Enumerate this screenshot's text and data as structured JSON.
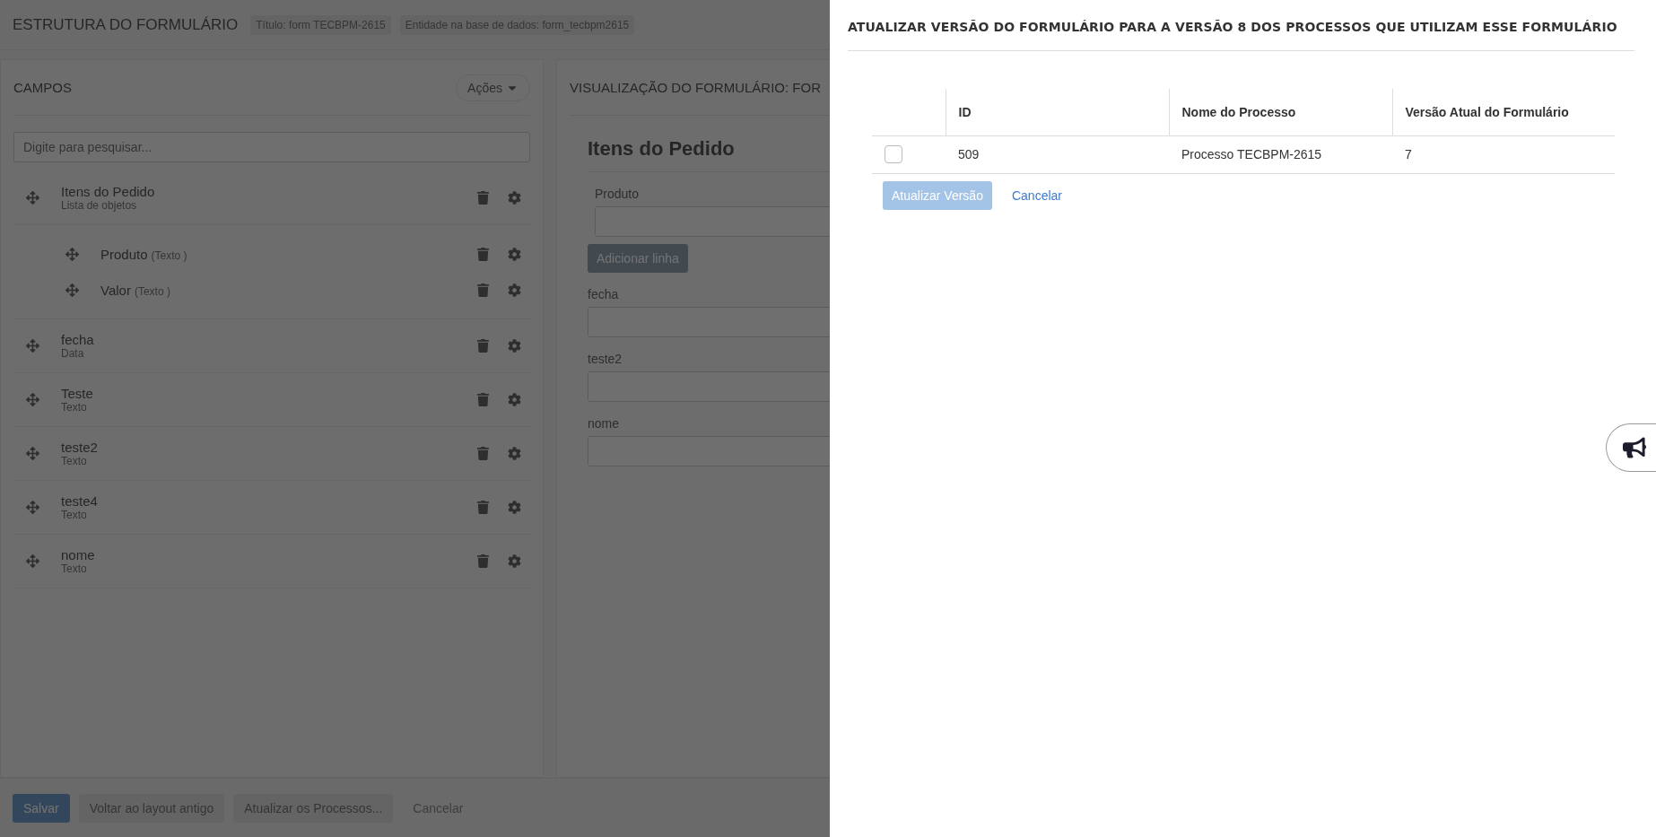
{
  "header": {
    "title": "ESTRUTURA DO FORMULÁRIO",
    "badges": [
      "Título: form TECBPM-2615",
      "Entidade na base de dados: form_tecbpm2615"
    ]
  },
  "fields_panel": {
    "title": "CAMPOS",
    "actions_button": "Ações",
    "search": {
      "placeholder": "Digite para pesquisar..."
    },
    "fields": [
      {
        "label": "Itens do Pedido",
        "type": "Lista de objetos",
        "children": [
          {
            "label": "Produto",
            "type": "(Texto )"
          },
          {
            "label": "Valor",
            "type": "(Texto )"
          }
        ]
      },
      {
        "label": "fecha",
        "type": "Data"
      },
      {
        "label": "Teste",
        "type": "Texto"
      },
      {
        "label": "teste2",
        "type": "Texto"
      },
      {
        "label": "teste4",
        "type": "Texto"
      },
      {
        "label": "nome",
        "type": "Texto"
      }
    ]
  },
  "preview": {
    "title": "VISUALIZAÇÃO DO FORMULÁRIO: FOR",
    "section": "Itens do Pedido",
    "section_field": "Produto",
    "add_button": "Adicionar linha",
    "fields": [
      "fecha",
      "teste2",
      "nome"
    ]
  },
  "footer": [
    {
      "kind": "primary",
      "label": "Salvar"
    },
    {
      "kind": "default",
      "label": "Voltar ao layout antigo"
    },
    {
      "kind": "default",
      "label": "Atualizar os Processos..."
    },
    {
      "kind": "link",
      "label": "Cancelar"
    }
  ],
  "drawer": {
    "title": "ATUALIZAR VERSÃO DO FORMULÁRIO PARA A VERSÃO 8 DOS PROCESSOS QUE UTILIZAM ESSE FORMULÁRIO",
    "columns": [
      "ID",
      "Nome do Processo",
      "Versão Atual do Formulário"
    ],
    "rows": [
      {
        "checked": false,
        "cells": [
          "509",
          "Processo TECBPM-2615",
          "7"
        ]
      }
    ],
    "update_button": {
      "label": "Atualizar Versão",
      "disabled": true
    },
    "cancel_link": "Cancelar"
  }
}
